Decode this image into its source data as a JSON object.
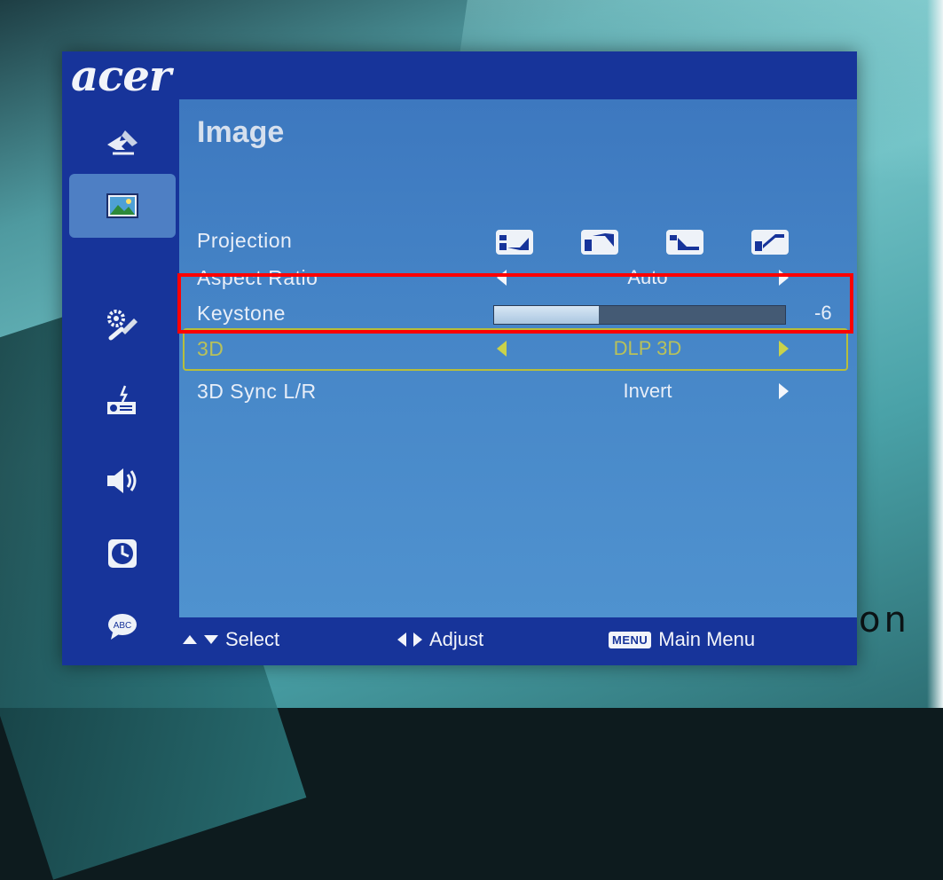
{
  "brand": {
    "logo": "acer",
    "background_fragment": "on"
  },
  "sidebar": {
    "items": [
      {
        "icon": "color-tools-icon",
        "active": false
      },
      {
        "icon": "image-icon",
        "active": true
      },
      {
        "icon": "settings-wrench-icon",
        "active": false
      },
      {
        "icon": "projector-icon",
        "active": false
      },
      {
        "icon": "speaker-icon",
        "active": false
      },
      {
        "icon": "timer-icon",
        "active": false
      },
      {
        "icon": "language-abc-icon",
        "active": false
      }
    ]
  },
  "menu": {
    "title": "Image",
    "rows": {
      "projection": {
        "label": "Projection",
        "options": [
          "front-desktop-icon",
          "front-ceiling-icon",
          "rear-desktop-icon",
          "rear-ceiling-icon"
        ]
      },
      "aspect_ratio": {
        "label": "Aspect Ratio",
        "value": "Auto"
      },
      "keystone": {
        "label": "Keystone",
        "value": "-6",
        "fill_fraction": 0.36
      },
      "three_d": {
        "label": "3D",
        "value": "DLP 3D",
        "highlighted": true
      },
      "sync": {
        "label": "3D Sync L/R",
        "value": "Invert"
      }
    }
  },
  "footer": {
    "select": "Select",
    "adjust": "Adjust",
    "menu_key": "MENU",
    "main_menu": "Main Menu"
  },
  "colors": {
    "panel": "#17349a",
    "content": "#4787c8",
    "highlight": "#b8c15a",
    "annotation": "#ff0000"
  }
}
